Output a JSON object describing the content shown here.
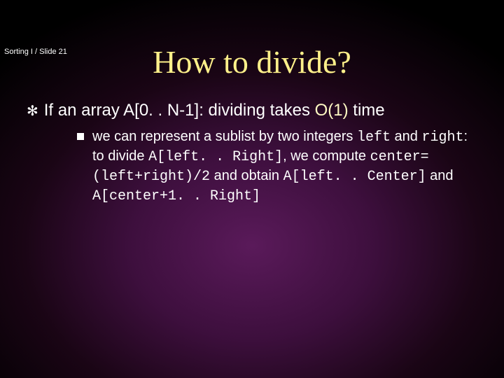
{
  "header": {
    "course": "Sorting I",
    "separator": "/",
    "slide_label": "Slide 21"
  },
  "title": "How to divide?",
  "bullet": {
    "prefix": "If an array A[0. . N-1]: dividing takes ",
    "highlight": "O(1)",
    "suffix": " time"
  },
  "sub": {
    "t1": " we can represent a sublist by two integers ",
    "c1": "left",
    "t2": " and ",
    "c2": "right",
    "t3": ": to divide ",
    "c3": "A[left. . Right]",
    "t4": ", we compute ",
    "c4": "center=(left+right)/2",
    "t5": " and obtain ",
    "c5": "A[left. . Center]",
    "t6": " and ",
    "c6": "A[center+1. . Right]"
  }
}
